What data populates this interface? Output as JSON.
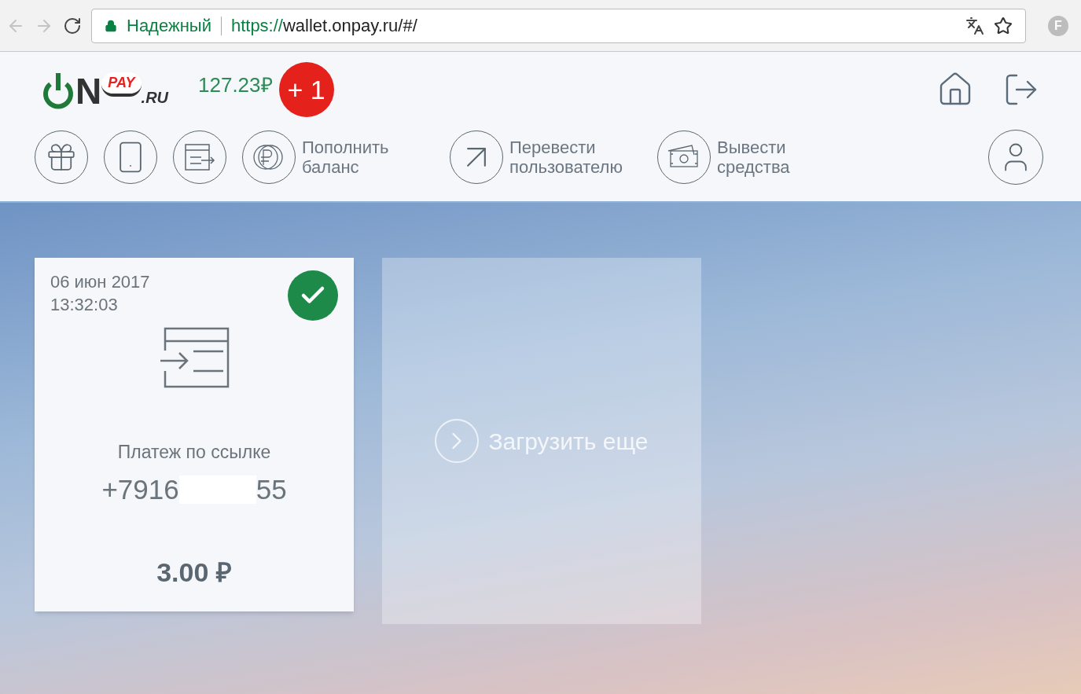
{
  "browser": {
    "security_label": "Надежный",
    "url_scheme": "https://",
    "url_rest": "wallet.onpay.ru/#/",
    "extension_letter": "F",
    "bookmarked": false
  },
  "header": {
    "logo": {
      "letter": "N",
      "badge": "PAY",
      "suffix": ".RU"
    },
    "balance": "127.23",
    "currency": "₽",
    "bonus": "+ 1"
  },
  "actions": [
    {
      "kind": "gift"
    },
    {
      "kind": "phone"
    },
    {
      "kind": "invoice"
    },
    {
      "kind": "coins",
      "label": "Пополнить баланс"
    },
    {
      "kind": "arrow",
      "label": "Перевести пользователю"
    },
    {
      "kind": "cash",
      "label": "Вывести средства"
    }
  ],
  "payments": [
    {
      "date": "06 июн 2017",
      "time": "13:32:03",
      "completed": true,
      "title": "Платеж по ссылке",
      "phone_start": "+7916",
      "phone_end": "55",
      "amount": "3.00 ₽"
    }
  ],
  "load_more": "Загрузить еще"
}
